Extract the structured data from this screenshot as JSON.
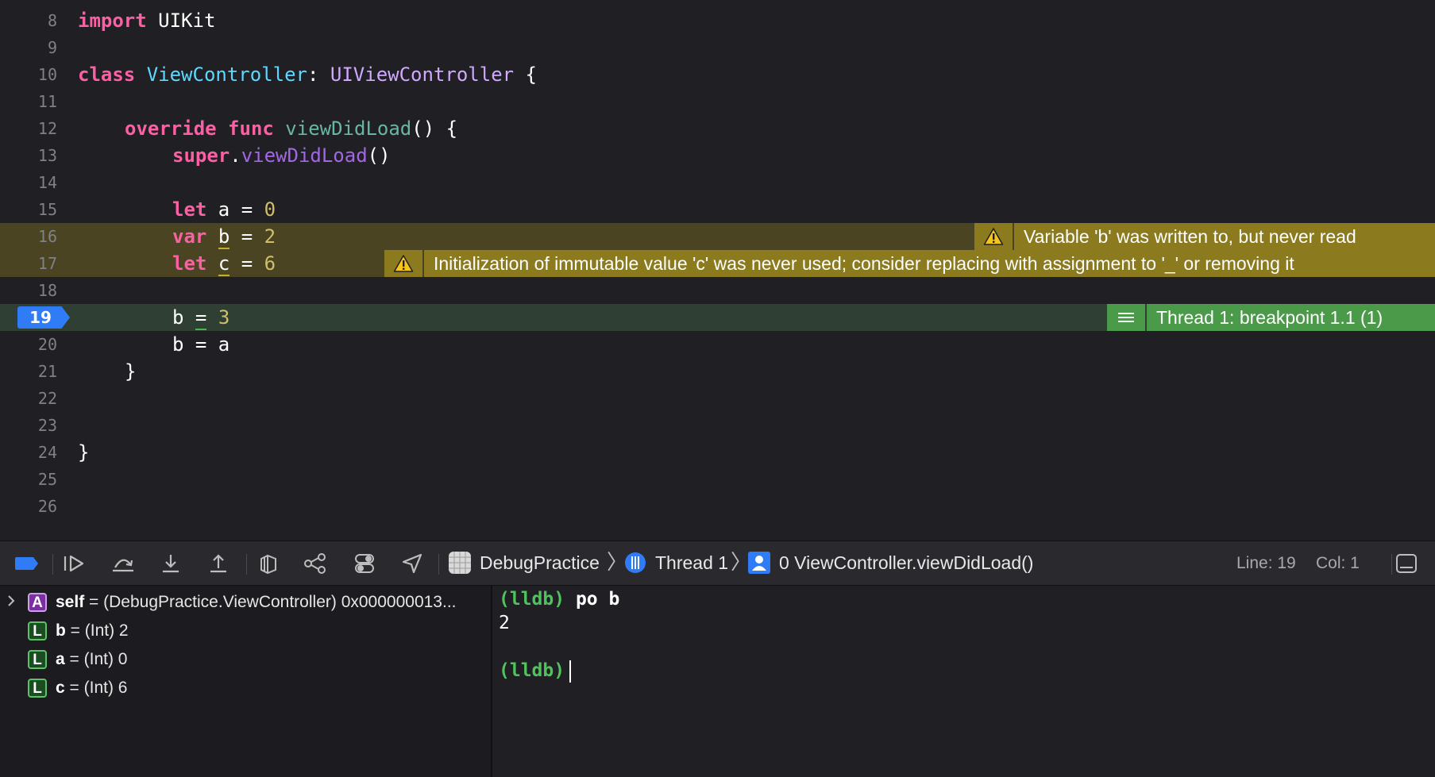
{
  "editor": {
    "lines": {
      "l8": {
        "num": "8",
        "kw": "import",
        "rest": " UIKit"
      },
      "l9": {
        "num": "9"
      },
      "l10": {
        "num": "10",
        "kw": "class",
        "name": "ViewController",
        "colon": ": ",
        "super": "UIViewController",
        "brace": " {"
      },
      "l11": {
        "num": "11"
      },
      "l12": {
        "num": "12",
        "kw1": "override",
        "kw2": "func",
        "name": "viewDidLoad",
        "rest": "() {"
      },
      "l13": {
        "num": "13",
        "kw": "super",
        "dot": ".",
        "call": "viewDidLoad",
        "rest": "()"
      },
      "l14": {
        "num": "14"
      },
      "l15": {
        "num": "15",
        "kw": "let",
        "a": " a = ",
        "val": "0"
      },
      "l16": {
        "num": "16",
        "kw": "var",
        "var": "b",
        "eq": " = ",
        "val": "2"
      },
      "l17": {
        "num": "17",
        "kw": "let",
        "var": "c",
        "eq": " = ",
        "val": "6"
      },
      "l18": {
        "num": "18"
      },
      "l19": {
        "num": "19",
        "var": "b ",
        "eq": "=",
        "val": "3"
      },
      "l20": {
        "num": "20",
        "text": "b = a"
      },
      "l21": {
        "num": "21",
        "text": "}"
      },
      "l22": {
        "num": "22"
      },
      "l23": {
        "num": "23"
      },
      "l24": {
        "num": "24",
        "text": "}"
      },
      "l25": {
        "num": "25"
      },
      "l26": {
        "num": "26"
      }
    },
    "issues": {
      "warn_b": "Variable 'b' was written to, but never read",
      "warn_c": "Initialization of immutable value 'c' was never used; consider replacing with assignment to '_' or removing it",
      "breakpoint": "Thread 1: breakpoint 1.1 (1)"
    },
    "colors": {
      "keyword": "#fc5fa3",
      "type": "#5dd8ff",
      "number": "#d0bf69",
      "warning": "#8b7a1e",
      "breakpoint": "#4a9a49",
      "marker": "#2f7cf6"
    }
  },
  "debug_bar": {
    "buttons": [
      "breakpoints-toggle-icon",
      "continue-icon",
      "step-over-icon",
      "step-into-icon",
      "step-out-icon",
      "debug-view-hierarchy-icon",
      "memory-graph-icon",
      "environment-overrides-icon",
      "simulate-location-icon"
    ],
    "app": "DebugPractice",
    "thread": "Thread 1",
    "frame": "0 ViewController.viewDidLoad()",
    "line": "Line: 19",
    "col": "Col: 1"
  },
  "variables": [
    {
      "badge": "A",
      "name": "self",
      "value": " = (DebugPractice.ViewController) 0x000000013..."
    },
    {
      "badge": "L",
      "name": "b",
      "value": " = (Int) 2"
    },
    {
      "badge": "L",
      "name": "a",
      "value": " = (Int) 0"
    },
    {
      "badge": "L",
      "name": "c",
      "value": " = (Int) 6"
    }
  ],
  "console": {
    "prompt1": "(lldb)",
    "cmd1": " po b",
    "out1": "2",
    "prompt2": "(lldb)"
  }
}
